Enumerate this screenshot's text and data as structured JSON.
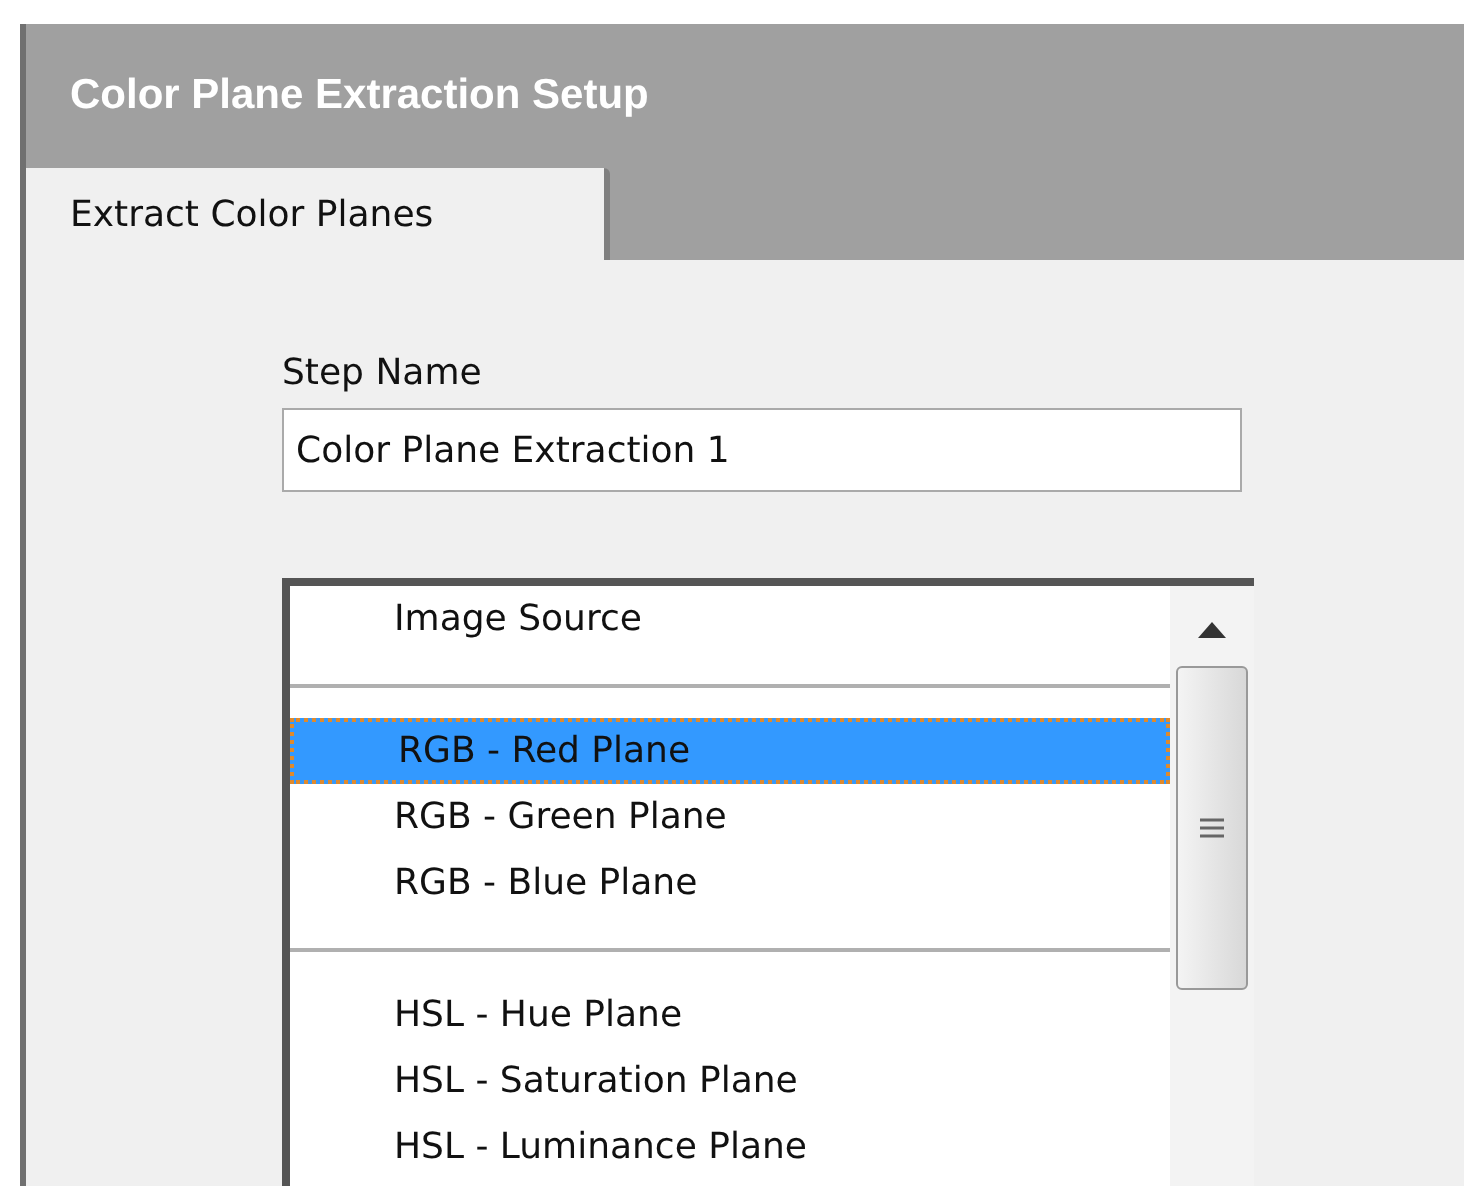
{
  "window": {
    "title": "Color Plane Extraction Setup"
  },
  "tabs": [
    {
      "label": "Extract Color Planes",
      "selected": true
    }
  ],
  "step_name": {
    "label": "Step Name",
    "value": "Color Plane Extraction 1"
  },
  "plane_list": [
    {
      "kind": "item",
      "label": "Image Source",
      "selected": false
    },
    {
      "kind": "separator"
    },
    {
      "kind": "item",
      "label": "RGB - Red Plane",
      "selected": true
    },
    {
      "kind": "item",
      "label": "RGB - Green Plane",
      "selected": false
    },
    {
      "kind": "item",
      "label": "RGB - Blue Plane",
      "selected": false
    },
    {
      "kind": "separator"
    },
    {
      "kind": "item",
      "label": "HSL - Hue Plane",
      "selected": false
    },
    {
      "kind": "item",
      "label": "HSL - Saturation Plane",
      "selected": false
    },
    {
      "kind": "item",
      "label": "HSL - Luminance Plane",
      "selected": false
    }
  ]
}
